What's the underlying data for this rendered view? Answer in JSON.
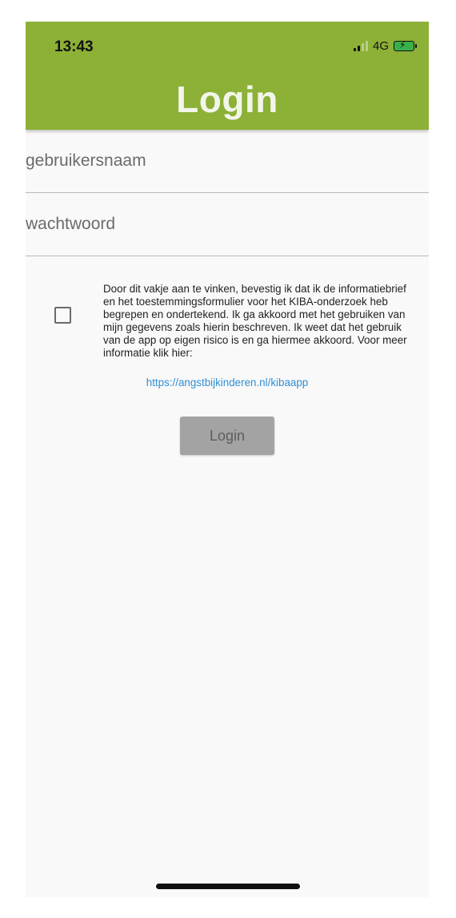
{
  "status_bar": {
    "time": "13:43",
    "network": "4G",
    "icons": [
      "signal-icon",
      "battery-charging-icon"
    ]
  },
  "app_bar": {
    "title": "Login",
    "background_color": "#8db037"
  },
  "form": {
    "username_placeholder": "gebruikersnaam",
    "username_value": "",
    "password_placeholder": "wachtwoord",
    "password_value": "",
    "consent_checked": false,
    "consent_text": "Door dit vakje aan te vinken, bevestig ik dat ik de informatiebrief en het toestemmingsformulier voor het KIBA-onderzoek heb begrepen en ondertekend. Ik ga akkoord met het gebruiken van mijn gegevens zoals hierin beschreven. Ik weet dat het gebruik van de app op eigen risico is en ga hiermee akkoord. Voor meer informatie klik hier:",
    "info_link": "https://angstbijkinderen.nl/kibaapp",
    "login_button_label": "Login",
    "link_color": "#2f8fd4",
    "disabled_button_color": "#a3a3a3"
  }
}
